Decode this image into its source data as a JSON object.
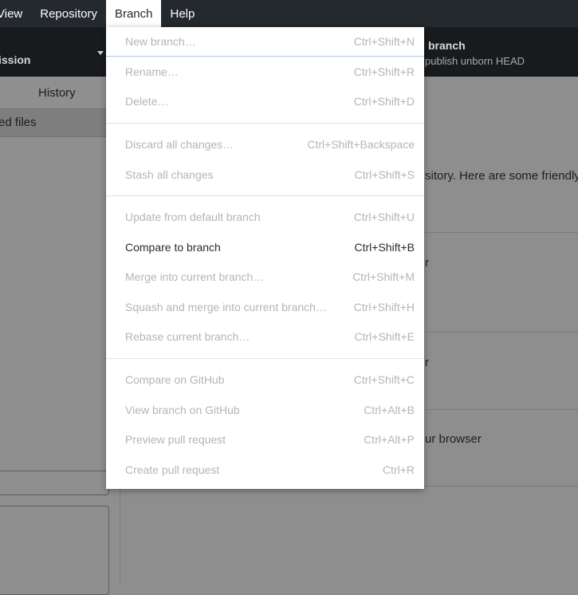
{
  "menubar": {
    "items": [
      {
        "label": "View"
      },
      {
        "label": "Repository"
      },
      {
        "label": "Branch"
      },
      {
        "label": "Help"
      }
    ]
  },
  "toolbar": {
    "repository_label": "ission",
    "publish_title": "branch",
    "publish_desc": "publish unborn HEAD"
  },
  "sidebar": {
    "history_tab": "History",
    "changed_files": "ed files"
  },
  "main": {
    "intro": "sitory. Here are some friendly",
    "card1": "r",
    "card2": "r",
    "card3": "ur browser"
  },
  "branch_menu": {
    "items": [
      {
        "label": "New branch…",
        "accel": "Ctrl+Shift+N"
      },
      {
        "label": "Rename…",
        "accel": "Ctrl+Shift+R"
      },
      {
        "label": "Delete…",
        "accel": "Ctrl+Shift+D"
      },
      {
        "label": "Discard all changes…",
        "accel": "Ctrl+Shift+Backspace"
      },
      {
        "label": "Stash all changes",
        "accel": "Ctrl+Shift+S"
      },
      {
        "label": "Update from default branch",
        "accel": "Ctrl+Shift+U"
      },
      {
        "label": "Compare to branch",
        "accel": "Ctrl+Shift+B"
      },
      {
        "label": "Merge into current branch…",
        "accel": "Ctrl+Shift+M"
      },
      {
        "label": "Squash and merge into current branch…",
        "accel": "Ctrl+Shift+H"
      },
      {
        "label": "Rebase current branch…",
        "accel": "Ctrl+Shift+E"
      },
      {
        "label": "Compare on GitHub",
        "accel": "Ctrl+Shift+C"
      },
      {
        "label": "View branch on GitHub",
        "accel": "Ctrl+Alt+B"
      },
      {
        "label": "Preview pull request",
        "accel": "Ctrl+Alt+P"
      },
      {
        "label": "Create pull request",
        "accel": "Ctrl+R"
      }
    ]
  },
  "colors": {
    "menubar_bg": "#24292e",
    "toolbar_bg": "#181b1e",
    "overlay_bg": "#8e8e8e",
    "menu_bg": "#ffffff",
    "disabled_text": "#b5b5b5",
    "enabled_text": "#2b2b2b"
  }
}
